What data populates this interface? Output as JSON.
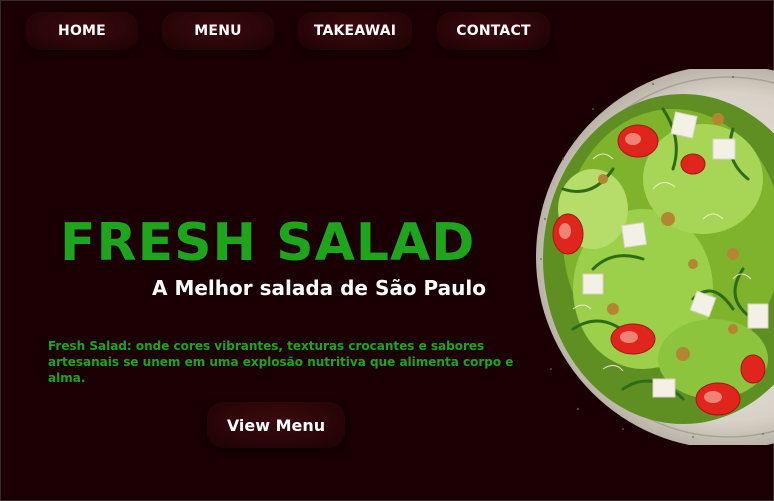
{
  "nav": {
    "home": "HOME",
    "menu": "MENU",
    "takeaway": "TAKEAWAI",
    "contact": "CONTACT"
  },
  "hero": {
    "title": "FRESH SALAD",
    "subtitle": "A Melhor salada de São Paulo",
    "description": "Fresh Salad: onde cores vibrantes, texturas crocantes e sabores artesanais se unem em uma explosão nutritiva que alimenta corpo e alma.",
    "cta_label": "View Menu"
  },
  "colors": {
    "background": "#1a0003",
    "accent_green": "#1fa51c",
    "button": "#2a0508"
  },
  "image": {
    "icon": "salad-bowl-image"
  }
}
